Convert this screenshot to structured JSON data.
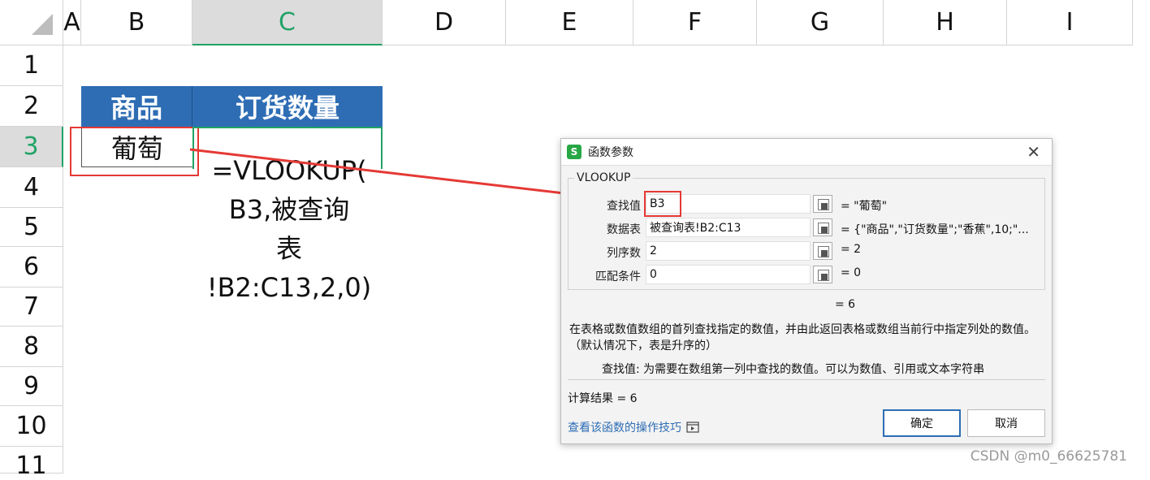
{
  "columns": [
    "A",
    "B",
    "C",
    "D",
    "E",
    "F",
    "G",
    "H",
    "I"
  ],
  "selected_column": "C",
  "rows": [
    "1",
    "2",
    "3",
    "4",
    "5",
    "6",
    "7",
    "8",
    "9",
    "10",
    "11"
  ],
  "selected_row": "3",
  "table": {
    "header_product": "商品",
    "header_qty": "订货数量",
    "b3": "葡萄"
  },
  "formula_lines": [
    "=VLOOKUP(",
    "B3,被查询",
    "表",
    "!B2:C13,2,0)"
  ],
  "dialog": {
    "title": "函数参数",
    "function_name": "VLOOKUP",
    "args": [
      {
        "label": "查找值",
        "value": "B3",
        "result": "= \"葡萄\""
      },
      {
        "label": "数据表",
        "value": "被查询表!B2:C13",
        "result": "= {\"商品\",\"订货数量\";\"香蕉\",10;\"..."
      },
      {
        "label": "列序数",
        "value": "2",
        "result": "= 2"
      },
      {
        "label": "匹配条件",
        "value": "0",
        "result": "= 0"
      }
    ],
    "equals_result": "= 6",
    "description": "在表格或数值数组的首列查找指定的数值，并由此返回表格或数组当前行中指定列处的数值。（默认情况下，表是升序的）",
    "arg_help": "查找值:  为需要在数组第一列中查找的数值。可以为数值、引用或文本字符串",
    "calc_result": "计算结果 = 6",
    "help_link": "查看该函数的操作技巧",
    "ok": "确定",
    "cancel": "取消"
  },
  "watermark": "CSDN @m0_66625781",
  "colors": {
    "header_blue": "#2e6db4",
    "selected_green": "#21a366",
    "annotation_red": "#e53935"
  }
}
